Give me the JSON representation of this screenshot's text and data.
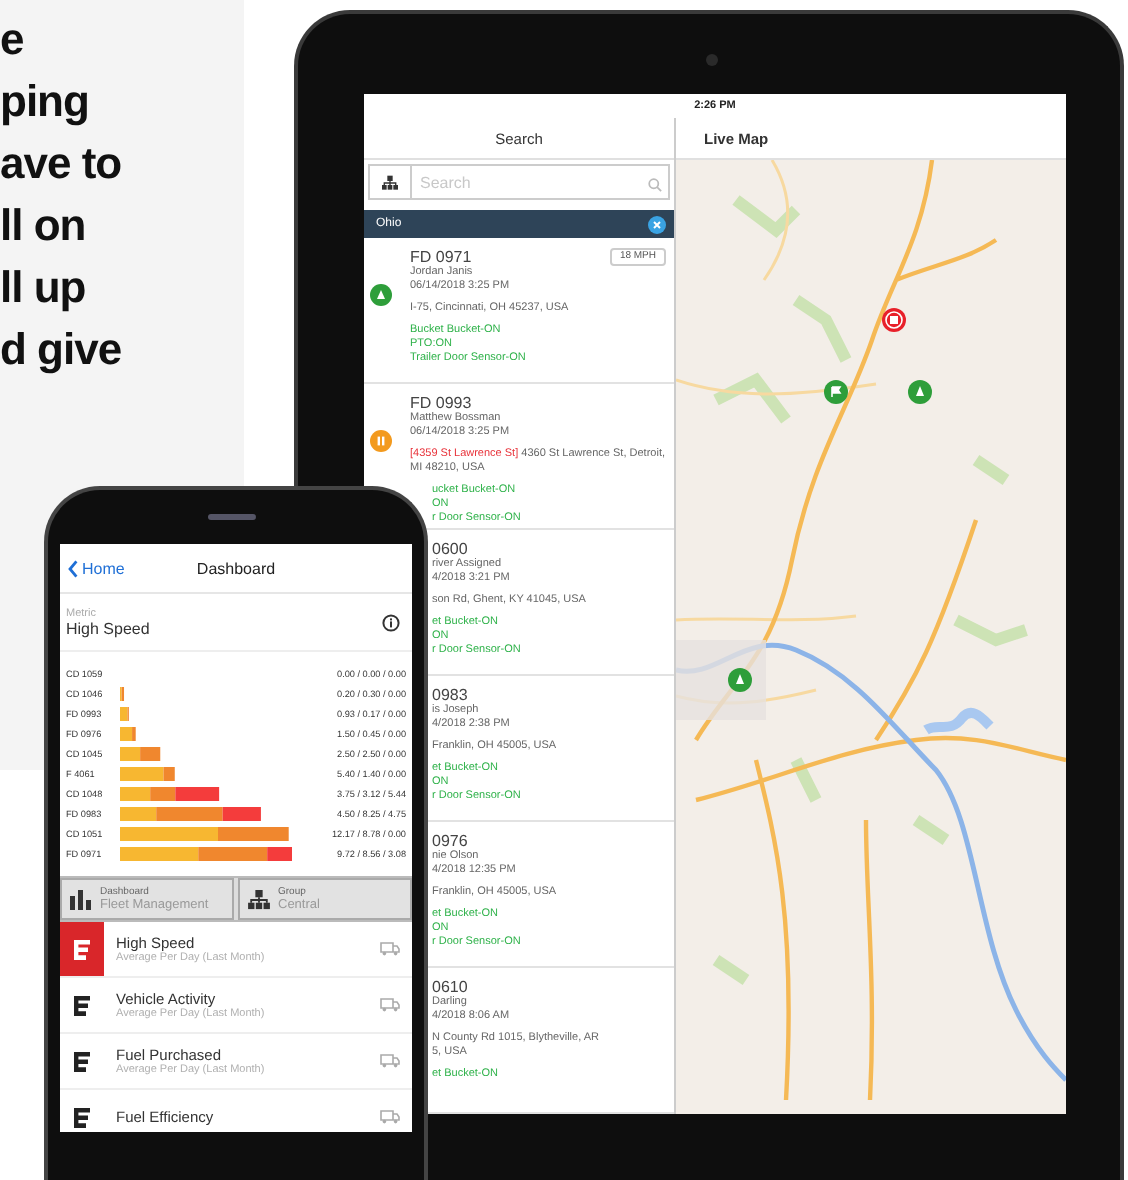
{
  "promo": {
    "lines": [
      "e",
      "ping",
      "ave to",
      "ll on",
      "ll up",
      "d give"
    ]
  },
  "tablet": {
    "status_time": "2:26 PM",
    "list_pane": {
      "title": "Search",
      "search": {
        "placeholder": "Search"
      },
      "group": "Ohio",
      "vehicles": [
        {
          "avatar": {
            "kind": "person",
            "color": "#2e9e3a"
          },
          "badge": "18 MPH",
          "lines": [
            {
              "kind": "title",
              "text": "FD 0971",
              "cut": false
            },
            {
              "kind": "name",
              "text": "Jordan Janis",
              "cut": false
            },
            {
              "kind": "date",
              "text": "06/14/2018 3:25 PM",
              "cut": false
            },
            {
              "kind": "address",
              "text": "I-75, Cincinnati, OH 45237, USA",
              "cut": false
            },
            {
              "kind": "status",
              "text": "Bucket Bucket-ON",
              "cut": false
            },
            {
              "kind": "status",
              "text": "PTO:ON",
              "cut": false
            },
            {
              "kind": "status",
              "text": "Trailer Door Sensor-ON",
              "cut": false
            }
          ]
        },
        {
          "avatar": {
            "kind": "pause",
            "color": "#f39a1e"
          },
          "lines": [
            {
              "kind": "title",
              "text": "FD 0993",
              "cut": false
            },
            {
              "kind": "name",
              "text": "Matthew Bossman",
              "cut": false
            },
            {
              "kind": "date",
              "text": "06/14/2018 3:25 PM",
              "cut": false
            },
            {
              "kind": "address",
              "alert": "[4359 St Lawrence St]",
              "text": "4360 St Lawrence St, Detroit, MI 48210, USA",
              "cut": false
            },
            {
              "kind": "status",
              "text": "ucket Bucket-ON",
              "cut": true
            },
            {
              "kind": "status",
              "text": "ON",
              "cut": true
            },
            {
              "kind": "status",
              "text": "r Door Sensor-ON",
              "cut": true
            }
          ]
        },
        {
          "lines": [
            {
              "kind": "title",
              "text": "0600",
              "cut": true
            },
            {
              "kind": "name",
              "text": "river Assigned",
              "cut": true
            },
            {
              "kind": "date",
              "text": "4/2018 3:21 PM",
              "cut": true
            },
            {
              "kind": "address",
              "text": "son Rd, Ghent, KY 41045, USA",
              "cut": true
            },
            {
              "kind": "status",
              "text": "et Bucket-ON",
              "cut": true
            },
            {
              "kind": "status",
              "text": "ON",
              "cut": true
            },
            {
              "kind": "status",
              "text": "r Door Sensor-ON",
              "cut": true
            }
          ]
        },
        {
          "lines": [
            {
              "kind": "title",
              "text": "0983",
              "cut": true
            },
            {
              "kind": "name",
              "text": "is Joseph",
              "cut": true
            },
            {
              "kind": "date",
              "text": "4/2018 2:38 PM",
              "cut": true
            },
            {
              "kind": "address",
              "text": "Franklin, OH 45005, USA",
              "cut": true
            },
            {
              "kind": "status",
              "text": "et Bucket-ON",
              "cut": true
            },
            {
              "kind": "status",
              "text": "ON",
              "cut": true
            },
            {
              "kind": "status",
              "text": "r Door Sensor-ON",
              "cut": true
            }
          ]
        },
        {
          "lines": [
            {
              "kind": "title",
              "text": "0976",
              "cut": true
            },
            {
              "kind": "name",
              "text": "nie Olson",
              "cut": true
            },
            {
              "kind": "date",
              "text": "4/2018 12:35 PM",
              "cut": true
            },
            {
              "kind": "address",
              "text": "Franklin, OH 45005, USA",
              "cut": true
            },
            {
              "kind": "status",
              "text": "et Bucket-ON",
              "cut": true
            },
            {
              "kind": "status",
              "text": "ON",
              "cut": true
            },
            {
              "kind": "status",
              "text": "r Door Sensor-ON",
              "cut": true
            }
          ]
        },
        {
          "lines": [
            {
              "kind": "title",
              "text": "0610",
              "cut": true
            },
            {
              "kind": "name",
              "text": "Darling",
              "cut": true
            },
            {
              "kind": "date",
              "text": "4/2018 8:06 AM",
              "cut": true
            },
            {
              "kind": "address",
              "text": "N County Rd 1015, Blytheville, AR",
              "cut": true
            },
            {
              "kind": "address",
              "text": "5, USA",
              "cut": true
            },
            {
              "kind": "status",
              "text": "et Bucket-ON",
              "cut": true
            }
          ]
        }
      ]
    },
    "map_pane": {
      "title": "Live Map",
      "markers": [
        {
          "kind": "stop",
          "color": "#e8202a"
        },
        {
          "kind": "flag",
          "color": "#2e9e3a"
        },
        {
          "kind": "person",
          "color": "#2e9e3a"
        },
        {
          "kind": "person",
          "color": "#2e9e3a"
        }
      ]
    }
  },
  "phone": {
    "back": "Home",
    "title": "Dashboard",
    "metric": {
      "label": "Metric",
      "value": "High Speed"
    },
    "chart_rows": [
      {
        "category": "CD 1059",
        "reading": "0.00 / 0.00 / 0.00"
      },
      {
        "category": "CD 1046",
        "reading": "0.20 / 0.30 / 0.00"
      },
      {
        "category": "FD 0993",
        "reading": "0.93 / 0.17 / 0.00"
      },
      {
        "category": "FD 0976",
        "reading": "1.50 / 0.45 / 0.00"
      },
      {
        "category": "CD 1045",
        "reading": "2.50 / 2.50 / 0.00"
      },
      {
        "category": "F 4061",
        "reading": "5.40 / 1.40 / 0.00"
      },
      {
        "category": "CD 1048",
        "reading": "3.75 / 3.12 / 5.44"
      },
      {
        "category": "FD 0983",
        "reading": "4.50 / 8.25 / 4.75"
      },
      {
        "category": "CD 1051",
        "reading": "12.17 / 8.78 / 0.00"
      },
      {
        "category": "FD 0971",
        "reading": "9.72 / 8.56 / 3.08"
      }
    ],
    "tabs": [
      {
        "kind": "dashboard",
        "caption": "Dashboard",
        "value": "Fleet Management"
      },
      {
        "kind": "group",
        "caption": "Group",
        "value": "Central"
      }
    ],
    "metrics": [
      {
        "title": "High Speed",
        "subtitle": "Average Per Day (Last Month)",
        "selected": true
      },
      {
        "title": "Vehicle Activity",
        "subtitle": "Average Per Day (Last Month)",
        "selected": false
      },
      {
        "title": "Fuel Purchased",
        "subtitle": "Average Per Day (Last Month)",
        "selected": false
      },
      {
        "title": "Fuel Efficiency",
        "selected": false
      }
    ]
  }
}
